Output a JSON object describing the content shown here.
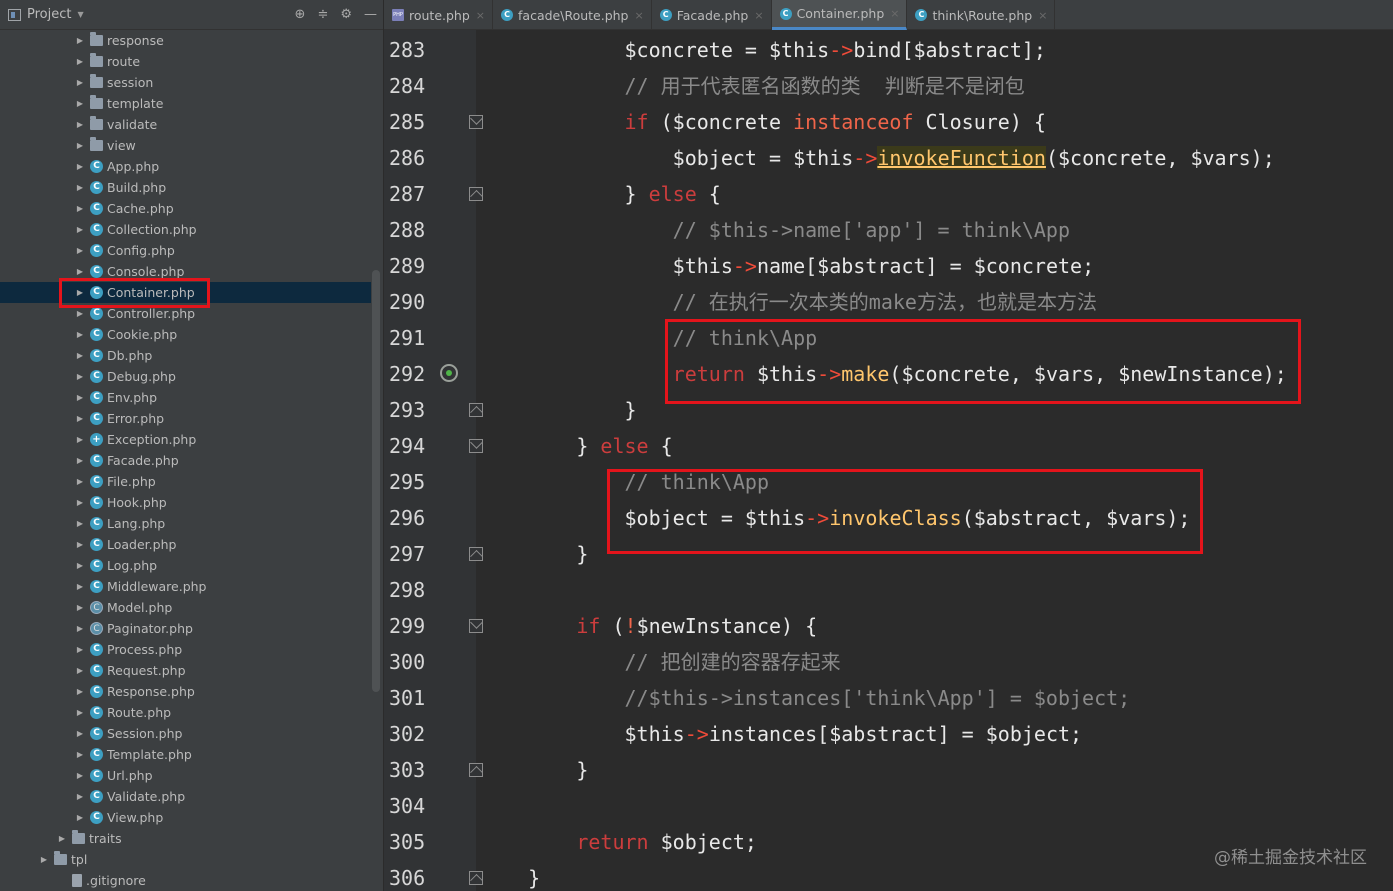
{
  "project_panel": {
    "title": "Project",
    "items": [
      {
        "label": "response",
        "type": "folder"
      },
      {
        "label": "route",
        "type": "folder"
      },
      {
        "label": "session",
        "type": "folder"
      },
      {
        "label": "template",
        "type": "folder"
      },
      {
        "label": "validate",
        "type": "folder"
      },
      {
        "label": "view",
        "type": "folder"
      },
      {
        "label": "App.php",
        "type": "class"
      },
      {
        "label": "Build.php",
        "type": "class"
      },
      {
        "label": "Cache.php",
        "type": "class"
      },
      {
        "label": "Collection.php",
        "type": "class"
      },
      {
        "label": "Config.php",
        "type": "class"
      },
      {
        "label": "Console.php",
        "type": "class"
      },
      {
        "label": "Container.php",
        "type": "class",
        "selected": true
      },
      {
        "label": "Controller.php",
        "type": "class"
      },
      {
        "label": "Cookie.php",
        "type": "class"
      },
      {
        "label": "Db.php",
        "type": "class"
      },
      {
        "label": "Debug.php",
        "type": "class"
      },
      {
        "label": "Env.php",
        "type": "class"
      },
      {
        "label": "Error.php",
        "type": "class"
      },
      {
        "label": "Exception.php",
        "type": "exception"
      },
      {
        "label": "Facade.php",
        "type": "class"
      },
      {
        "label": "File.php",
        "type": "class"
      },
      {
        "label": "Hook.php",
        "type": "class"
      },
      {
        "label": "Lang.php",
        "type": "class"
      },
      {
        "label": "Loader.php",
        "type": "class"
      },
      {
        "label": "Log.php",
        "type": "class"
      },
      {
        "label": "Middleware.php",
        "type": "class"
      },
      {
        "label": "Model.php",
        "type": "abstract"
      },
      {
        "label": "Paginator.php",
        "type": "abstract"
      },
      {
        "label": "Process.php",
        "type": "class"
      },
      {
        "label": "Request.php",
        "type": "class"
      },
      {
        "label": "Response.php",
        "type": "class"
      },
      {
        "label": "Route.php",
        "type": "class"
      },
      {
        "label": "Session.php",
        "type": "class"
      },
      {
        "label": "Template.php",
        "type": "class"
      },
      {
        "label": "Url.php",
        "type": "class"
      },
      {
        "label": "Validate.php",
        "type": "class"
      },
      {
        "label": "View.php",
        "type": "class"
      },
      {
        "label": "traits",
        "type": "folder"
      },
      {
        "label": "tpl",
        "type": "folder"
      },
      {
        "label": ".gitignore",
        "type": "file"
      }
    ]
  },
  "tabs": [
    {
      "label": "route.php",
      "icon": "php-file-icon",
      "active": false
    },
    {
      "label": "facade\\Route.php",
      "icon": "class-icon",
      "active": false
    },
    {
      "label": "Facade.php",
      "icon": "class-icon",
      "active": false
    },
    {
      "label": "Container.php",
      "icon": "class-icon",
      "active": true
    },
    {
      "label": "think\\Route.php",
      "icon": "class-icon",
      "active": false
    }
  ],
  "editor": {
    "line_numbers": [
      "283",
      "284",
      "285",
      "286",
      "287",
      "288",
      "289",
      "290",
      "291",
      "292",
      "293",
      "294",
      "295",
      "296",
      "297",
      "298",
      "299",
      "300",
      "301",
      "302",
      "303",
      "304",
      "305",
      "306"
    ],
    "lines": [
      [
        [
          "",
          "            "
        ],
        [
          "v",
          "$concrete"
        ],
        [
          "op",
          " = "
        ],
        [
          "v",
          "$this"
        ],
        [
          "arr",
          "->"
        ],
        [
          "v",
          "bind[$abstract];"
        ]
      ],
      [
        [
          "",
          "            "
        ],
        [
          "cm",
          "// 用于代表匿名函数的类  判断是不是闭包"
        ]
      ],
      [
        [
          "",
          "            "
        ],
        [
          "kw",
          "if"
        ],
        [
          "v",
          " ($concrete "
        ],
        [
          "kwo",
          "instanceof"
        ],
        [
          "v",
          " Closure) {"
        ]
      ],
      [
        [
          "",
          "                "
        ],
        [
          "v",
          "$object"
        ],
        [
          "op",
          " = "
        ],
        [
          "v",
          "$this"
        ],
        [
          "arr",
          "->"
        ],
        [
          "fnu",
          "invokeFunction"
        ],
        [
          "v",
          "($concrete, $vars);"
        ]
      ],
      [
        [
          "",
          "            "
        ],
        [
          "v",
          "} "
        ],
        [
          "kw",
          "else"
        ],
        [
          "v",
          " {"
        ]
      ],
      [
        [
          "",
          "                "
        ],
        [
          "cm",
          "// $this->name['app'] = think\\App"
        ]
      ],
      [
        [
          "",
          "                "
        ],
        [
          "v",
          "$this"
        ],
        [
          "arr",
          "->"
        ],
        [
          "v",
          "name[$abstract]"
        ],
        [
          "op",
          " = "
        ],
        [
          "v",
          "$concrete;"
        ]
      ],
      [
        [
          "",
          "                "
        ],
        [
          "cm",
          "// 在执行一次本类的make方法，也就是本方法"
        ]
      ],
      [
        [
          "",
          "                "
        ],
        [
          "cm",
          "// think\\App"
        ]
      ],
      [
        [
          "",
          "                "
        ],
        [
          "kw",
          "return"
        ],
        [
          "v",
          " $this"
        ],
        [
          "arr",
          "->"
        ],
        [
          "fn",
          "make"
        ],
        [
          "v",
          "($concrete, $vars, $newInstance);"
        ]
      ],
      [
        [
          "",
          "            "
        ],
        [
          "v",
          "}"
        ]
      ],
      [
        [
          "",
          "        "
        ],
        [
          "v",
          "} "
        ],
        [
          "kw",
          "else"
        ],
        [
          "v",
          " {"
        ]
      ],
      [
        [
          "",
          "            "
        ],
        [
          "cm",
          "// think\\App"
        ]
      ],
      [
        [
          "",
          "            "
        ],
        [
          "v",
          "$object"
        ],
        [
          "op",
          " = "
        ],
        [
          "v",
          "$this"
        ],
        [
          "arr",
          "->"
        ],
        [
          "fn",
          "invokeClass"
        ],
        [
          "v",
          "($abstract, $vars);"
        ]
      ],
      [
        [
          "",
          "        "
        ],
        [
          "v",
          "}"
        ]
      ],
      [
        [
          "",
          ""
        ]
      ],
      [
        [
          "",
          "        "
        ],
        [
          "kw",
          "if"
        ],
        [
          "v",
          " ("
        ],
        [
          "kwo",
          "!"
        ],
        [
          "v",
          "$newInstance) {"
        ]
      ],
      [
        [
          "",
          "            "
        ],
        [
          "cm",
          "// 把创建的容器存起来"
        ]
      ],
      [
        [
          "",
          "            "
        ],
        [
          "cm",
          "//$this->instances['think\\App'] = $object;"
        ]
      ],
      [
        [
          "",
          "            "
        ],
        [
          "v",
          "$this"
        ],
        [
          "arr",
          "->"
        ],
        [
          "v",
          "instances[$abstract]"
        ],
        [
          "op",
          " = "
        ],
        [
          "v",
          "$object;"
        ]
      ],
      [
        [
          "",
          "        "
        ],
        [
          "v",
          "}"
        ]
      ],
      [
        [
          "",
          ""
        ]
      ],
      [
        [
          "",
          "        "
        ],
        [
          "kw",
          "return"
        ],
        [
          "v",
          " $object;"
        ]
      ],
      [
        [
          "",
          "    "
        ],
        [
          "v",
          "}"
        ]
      ]
    ]
  },
  "watermark": "@稀土掘金技术社区",
  "colors": {
    "accent_highlight": "#e4141b",
    "selection": "#0d293e",
    "keyword": "#cc3d3d",
    "function": "#ffc66d",
    "comment": "#8a8a8a"
  }
}
